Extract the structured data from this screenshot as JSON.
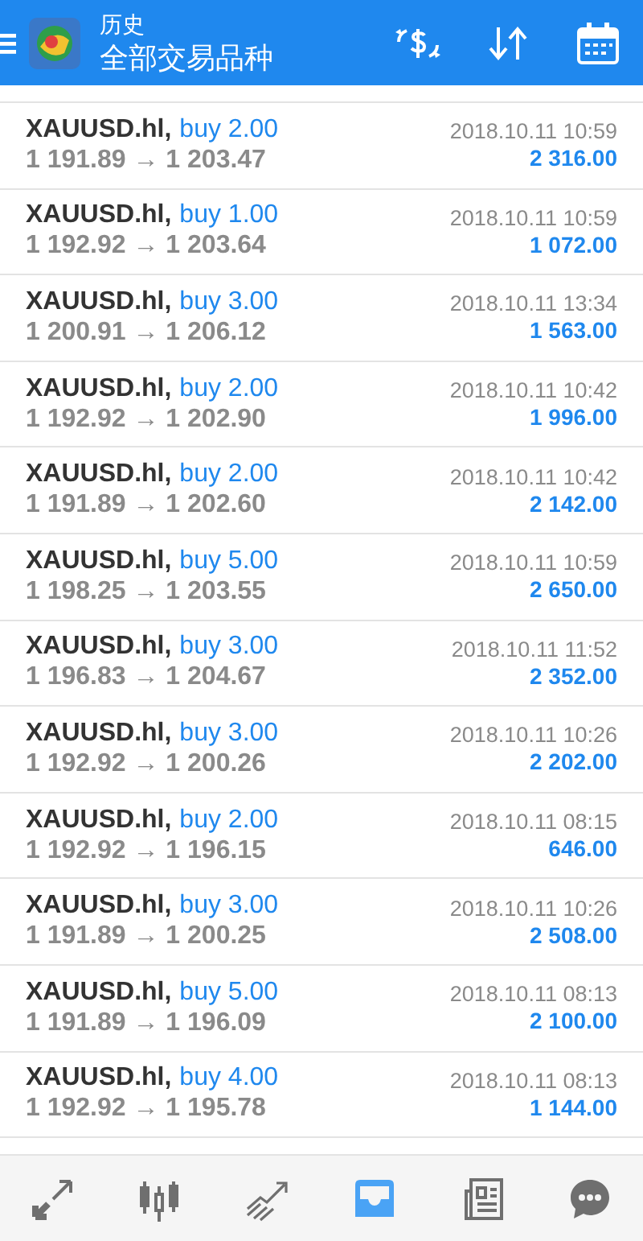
{
  "header": {
    "title": "历史",
    "subtitle": "全部交易品种"
  },
  "deals": [
    {
      "symbol": "XAUUSD.hl,",
      "action": "buy 2.00",
      "prices": "1 191.89 → 1 203.47",
      "time": "2018.10.11 10:59",
      "profit": "2 316.00"
    },
    {
      "symbol": "XAUUSD.hl,",
      "action": "buy 1.00",
      "prices": "1 192.92 → 1 203.64",
      "time": "2018.10.11 10:59",
      "profit": "1 072.00"
    },
    {
      "symbol": "XAUUSD.hl,",
      "action": "buy 3.00",
      "prices": "1 200.91 → 1 206.12",
      "time": "2018.10.11 13:34",
      "profit": "1 563.00"
    },
    {
      "symbol": "XAUUSD.hl,",
      "action": "buy 2.00",
      "prices": "1 192.92 → 1 202.90",
      "time": "2018.10.11 10:42",
      "profit": "1 996.00"
    },
    {
      "symbol": "XAUUSD.hl,",
      "action": "buy 2.00",
      "prices": "1 191.89 → 1 202.60",
      "time": "2018.10.11 10:42",
      "profit": "2 142.00"
    },
    {
      "symbol": "XAUUSD.hl,",
      "action": "buy 5.00",
      "prices": "1 198.25 → 1 203.55",
      "time": "2018.10.11 10:59",
      "profit": "2 650.00"
    },
    {
      "symbol": "XAUUSD.hl,",
      "action": "buy 3.00",
      "prices": "1 196.83 → 1 204.67",
      "time": "2018.10.11 11:52",
      "profit": "2 352.00"
    },
    {
      "symbol": "XAUUSD.hl,",
      "action": "buy 3.00",
      "prices": "1 192.92 → 1 200.26",
      "time": "2018.10.11 10:26",
      "profit": "2 202.00"
    },
    {
      "symbol": "XAUUSD.hl,",
      "action": "buy 2.00",
      "prices": "1 192.92 → 1 196.15",
      "time": "2018.10.11 08:15",
      "profit": "646.00"
    },
    {
      "symbol": "XAUUSD.hl,",
      "action": "buy 3.00",
      "prices": "1 191.89 → 1 200.25",
      "time": "2018.10.11 10:26",
      "profit": "2 508.00"
    },
    {
      "symbol": "XAUUSD.hl,",
      "action": "buy 5.00",
      "prices": "1 191.89 → 1 196.09",
      "time": "2018.10.11 08:13",
      "profit": "2 100.00"
    },
    {
      "symbol": "XAUUSD.hl,",
      "action": "buy 4.00",
      "prices": "1 192.92 → 1 195.78",
      "time": "2018.10.11 08:13",
      "profit": "1 144.00"
    }
  ],
  "bottom_nav": [
    {
      "kind": "quotes",
      "selected": false
    },
    {
      "kind": "chart",
      "selected": false
    },
    {
      "kind": "trade",
      "selected": false
    },
    {
      "kind": "history",
      "selected": true
    },
    {
      "kind": "news",
      "selected": false
    },
    {
      "kind": "chat",
      "selected": false
    }
  ]
}
